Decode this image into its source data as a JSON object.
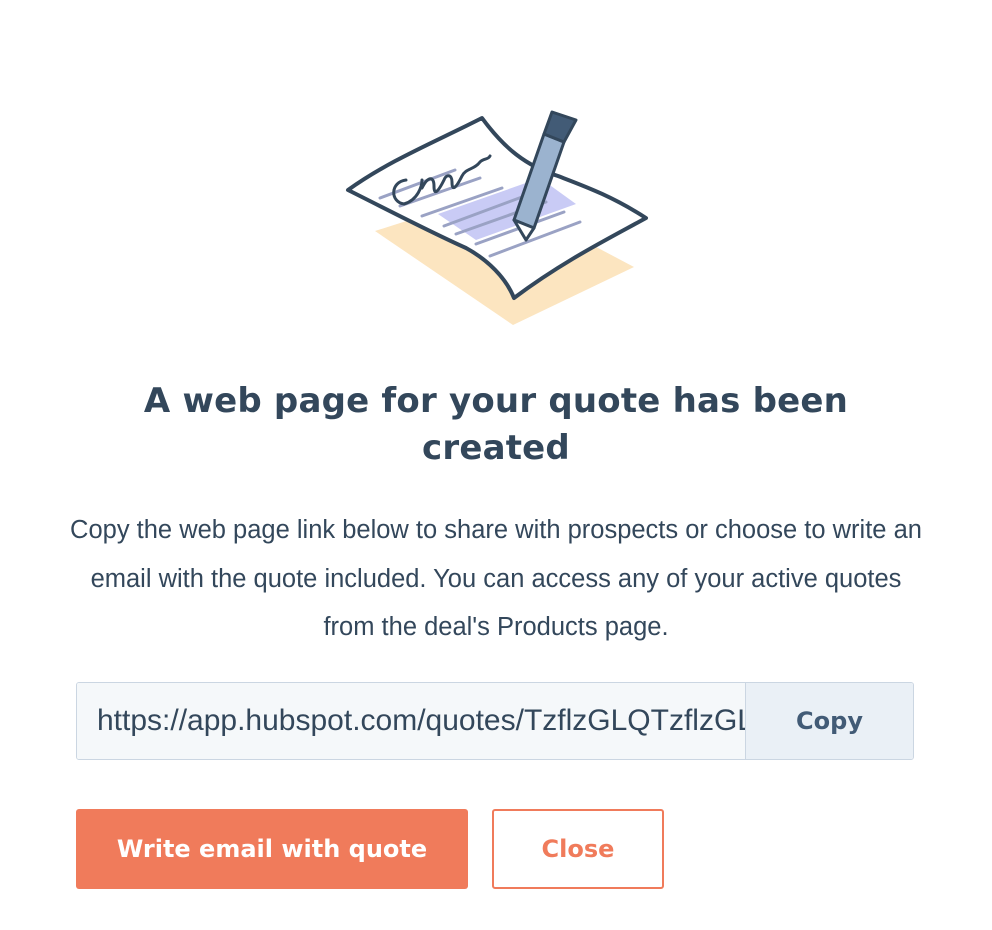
{
  "illustration": {
    "name": "signed-document-illustration",
    "colors": {
      "outline": "#33475b",
      "shadow": "#fce5c0",
      "highlight": "#c9cbf5",
      "pen_body": "#9bb3cf",
      "pen_cap": "#425b76"
    }
  },
  "dialog": {
    "title": "A web page for your quote has been created",
    "description": "Copy the web page link below to share with prospects or choose to write an email with the quote included. You can access any of your active quotes from the deal's Products page."
  },
  "link": {
    "value": "https://app.hubspot.com/quotes/TzflzGLQTzflzGLQT",
    "copy_label": "Copy"
  },
  "actions": {
    "primary_label": "Write email with quote",
    "secondary_label": "Close"
  },
  "colors": {
    "text": "#33475b",
    "accent": "#f07b5b",
    "input_bg": "#f5f8fa",
    "border": "#cbd6e2",
    "copy_bg": "#eaf0f6"
  }
}
